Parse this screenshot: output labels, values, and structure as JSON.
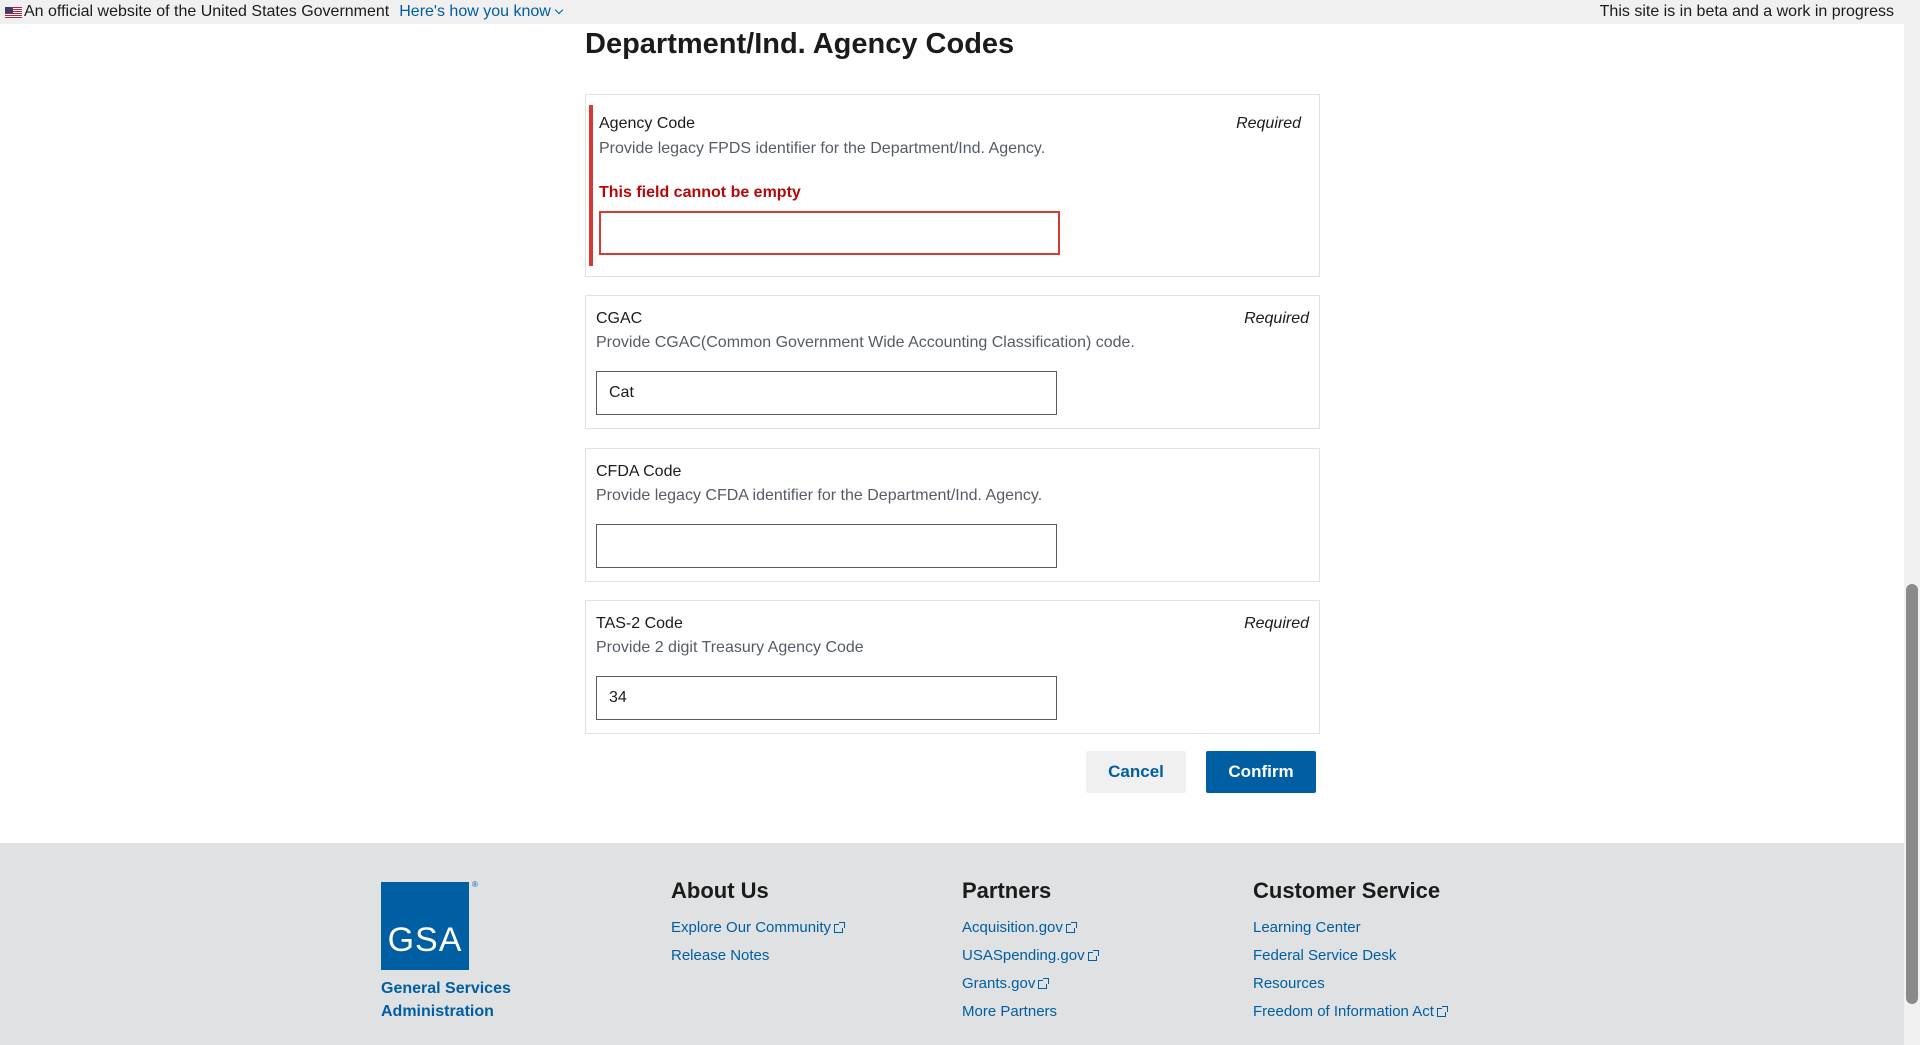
{
  "banner": {
    "official_text": "An official website of the United States Government",
    "how_link": "Here's how you know",
    "beta_text": "This site is in beta and a work in progress"
  },
  "page": {
    "title": "Department/Ind. Agency Codes"
  },
  "fields": [
    {
      "label": "Agency Code",
      "required": "Required",
      "hint": "Provide legacy FPDS identifier for the Department/Ind. Agency.",
      "error": "This field cannot be empty",
      "value": ""
    },
    {
      "label": "CGAC",
      "required": "Required",
      "hint": "Provide CGAC(Common Government Wide Accounting Classification) code.",
      "value": "Cat"
    },
    {
      "label": "CFDA Code",
      "hint": "Provide legacy CFDA identifier for the Department/Ind. Agency.",
      "value": ""
    },
    {
      "label": "TAS-2 Code",
      "required": "Required",
      "hint": "Provide 2 digit Treasury Agency Code",
      "value": "34"
    }
  ],
  "actions": {
    "cancel": "Cancel",
    "confirm": "Confirm"
  },
  "footer": {
    "logo_text": "GSA",
    "logo_mark": "®",
    "org_line1": "General Services",
    "org_line2": "Administration",
    "about": {
      "heading": "About Us",
      "links": [
        "Explore Our Community",
        "Release Notes"
      ]
    },
    "partners": {
      "heading": "Partners",
      "links": [
        "Acquisition.gov",
        "USASpending.gov",
        "Grants.gov",
        "More Partners"
      ]
    },
    "customer": {
      "heading": "Customer Service",
      "links": [
        "Learning Center",
        "Federal Service Desk",
        "Resources",
        "Freedom of Information Act"
      ]
    }
  }
}
